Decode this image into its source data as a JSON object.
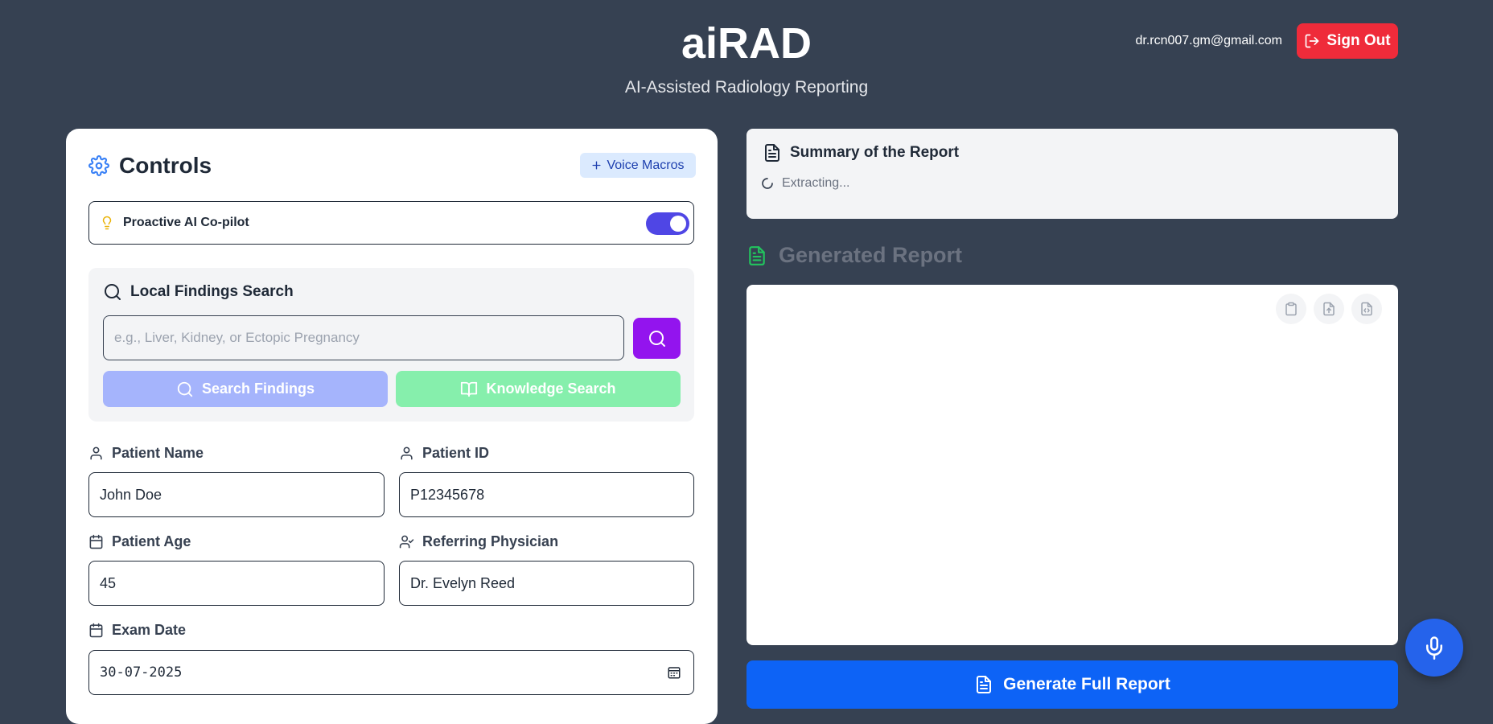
{
  "header": {
    "title": "aiRAD",
    "subtitle": "AI-Assisted Radiology Reporting",
    "user_email": "dr.rcn007.gm@gmail.com",
    "sign_out_label": "Sign Out",
    "sign_out_icon": "sign-out-icon"
  },
  "controls": {
    "title": "Controls",
    "title_icon": "gear-icon",
    "voice_macros_label": "Voice Macros",
    "copilot": {
      "label": "Proactive AI Co-pilot",
      "icon": "lightbulb-icon",
      "enabled": true
    },
    "search": {
      "heading": "Local Findings Search",
      "placeholder": "e.g., Liver, Kidney, or Ectopic Pregnancy",
      "value": "",
      "search_findings_label": "Search Findings",
      "knowledge_search_label": "Knowledge Search"
    },
    "fields": {
      "patient_name": {
        "label": "Patient Name",
        "value": "John Doe"
      },
      "patient_id": {
        "label": "Patient ID",
        "value": "P12345678"
      },
      "patient_age": {
        "label": "Patient Age",
        "value": "45"
      },
      "referring_physician": {
        "label": "Referring Physician",
        "value": "Dr. Evelyn Reed"
      },
      "exam_date": {
        "label": "Exam Date",
        "value": "30-07-2025"
      }
    }
  },
  "summary": {
    "title": "Summary of the Report",
    "status": "Extracting..."
  },
  "report": {
    "title": "Generated Report",
    "tools": [
      "clipboard-icon",
      "file-upload-icon",
      "file-code-icon"
    ],
    "generate_label": "Generate Full Report"
  },
  "colors": {
    "background": "#364152",
    "sign_out": "#ef2b3a",
    "toggle_on": "#4f46e5",
    "search_go": "#9314ee",
    "search_findings": "#a5b4fc",
    "knowledge_search": "#86efac",
    "generate": "#0d63f6",
    "mic_fab": "#2563eb"
  }
}
